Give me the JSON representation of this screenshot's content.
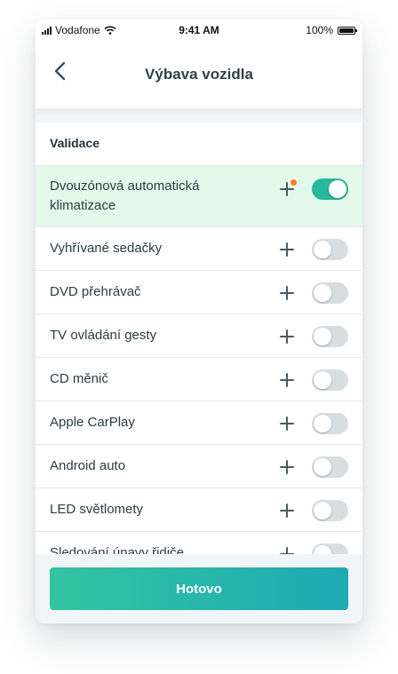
{
  "status_bar": {
    "carrier": "Vodafone",
    "time": "9:41 AM",
    "battery": "100%"
  },
  "nav": {
    "title": "Výbava vozidla",
    "back_icon": "chevron-left-icon"
  },
  "section": {
    "title": "Validace"
  },
  "items": [
    {
      "label": "Dvouzónová automatická klimatizace",
      "enabled": true,
      "has_badge": true
    },
    {
      "label": "Vyhřívané sedačky",
      "enabled": false,
      "has_badge": false
    },
    {
      "label": "DVD přehrávač",
      "enabled": false,
      "has_badge": false
    },
    {
      "label": "TV ovládání gesty",
      "enabled": false,
      "has_badge": false
    },
    {
      "label": "CD měnič",
      "enabled": false,
      "has_badge": false
    },
    {
      "label": "Apple CarPlay",
      "enabled": false,
      "has_badge": false
    },
    {
      "label": "Android auto",
      "enabled": false,
      "has_badge": false
    },
    {
      "label": "LED světlomety",
      "enabled": false,
      "has_badge": false
    },
    {
      "label": "Sledování únavy řidiče",
      "enabled": false,
      "has_badge": false
    }
  ],
  "footer": {
    "done_label": "Hotovo"
  },
  "colors": {
    "accent": "#27b99b",
    "active_row": "#e3f9e9",
    "badge": "#ff7a2a",
    "toggle_off": "#d8dde0"
  }
}
